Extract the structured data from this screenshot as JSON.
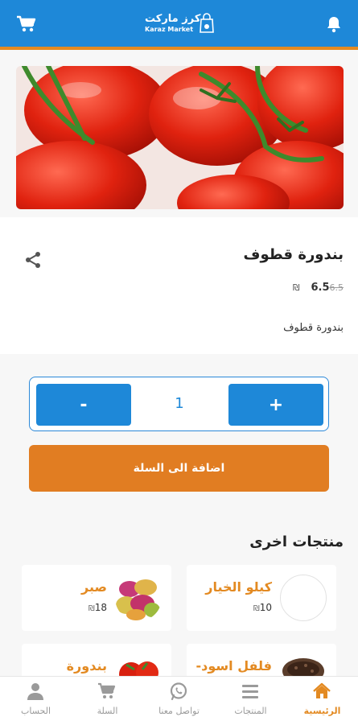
{
  "header": {
    "logo_ar": "كرز ماركت",
    "logo_en": "Karaz Market"
  },
  "product": {
    "title": "بندورة قطوف",
    "currency": "₪",
    "price": "6.5",
    "old_price": "6.5",
    "description": "بندورة قطوف"
  },
  "quantity": {
    "plus": "+",
    "value": "1",
    "minus": "-"
  },
  "actions": {
    "add_to_cart": "اضافة الى السلة"
  },
  "other_products": {
    "title": "منتجات اخرى",
    "items": [
      {
        "name": "كيلو  الخيار",
        "currency": "₪",
        "price": "10"
      },
      {
        "name": "صبر",
        "currency": "₪",
        "price": "18"
      },
      {
        "name": "فلفل اسود-",
        "currency": "₪",
        "price": ""
      },
      {
        "name": "بندورة",
        "currency": "₪",
        "price": ""
      }
    ]
  },
  "nav": {
    "home": "الرئيسية",
    "products": "المنتجات",
    "contact": "تواصل معنا",
    "cart": "السلة",
    "account": "الحساب"
  },
  "colors": {
    "primary": "#1e88d8",
    "accent": "#e17d22",
    "active": "#e38a22"
  }
}
